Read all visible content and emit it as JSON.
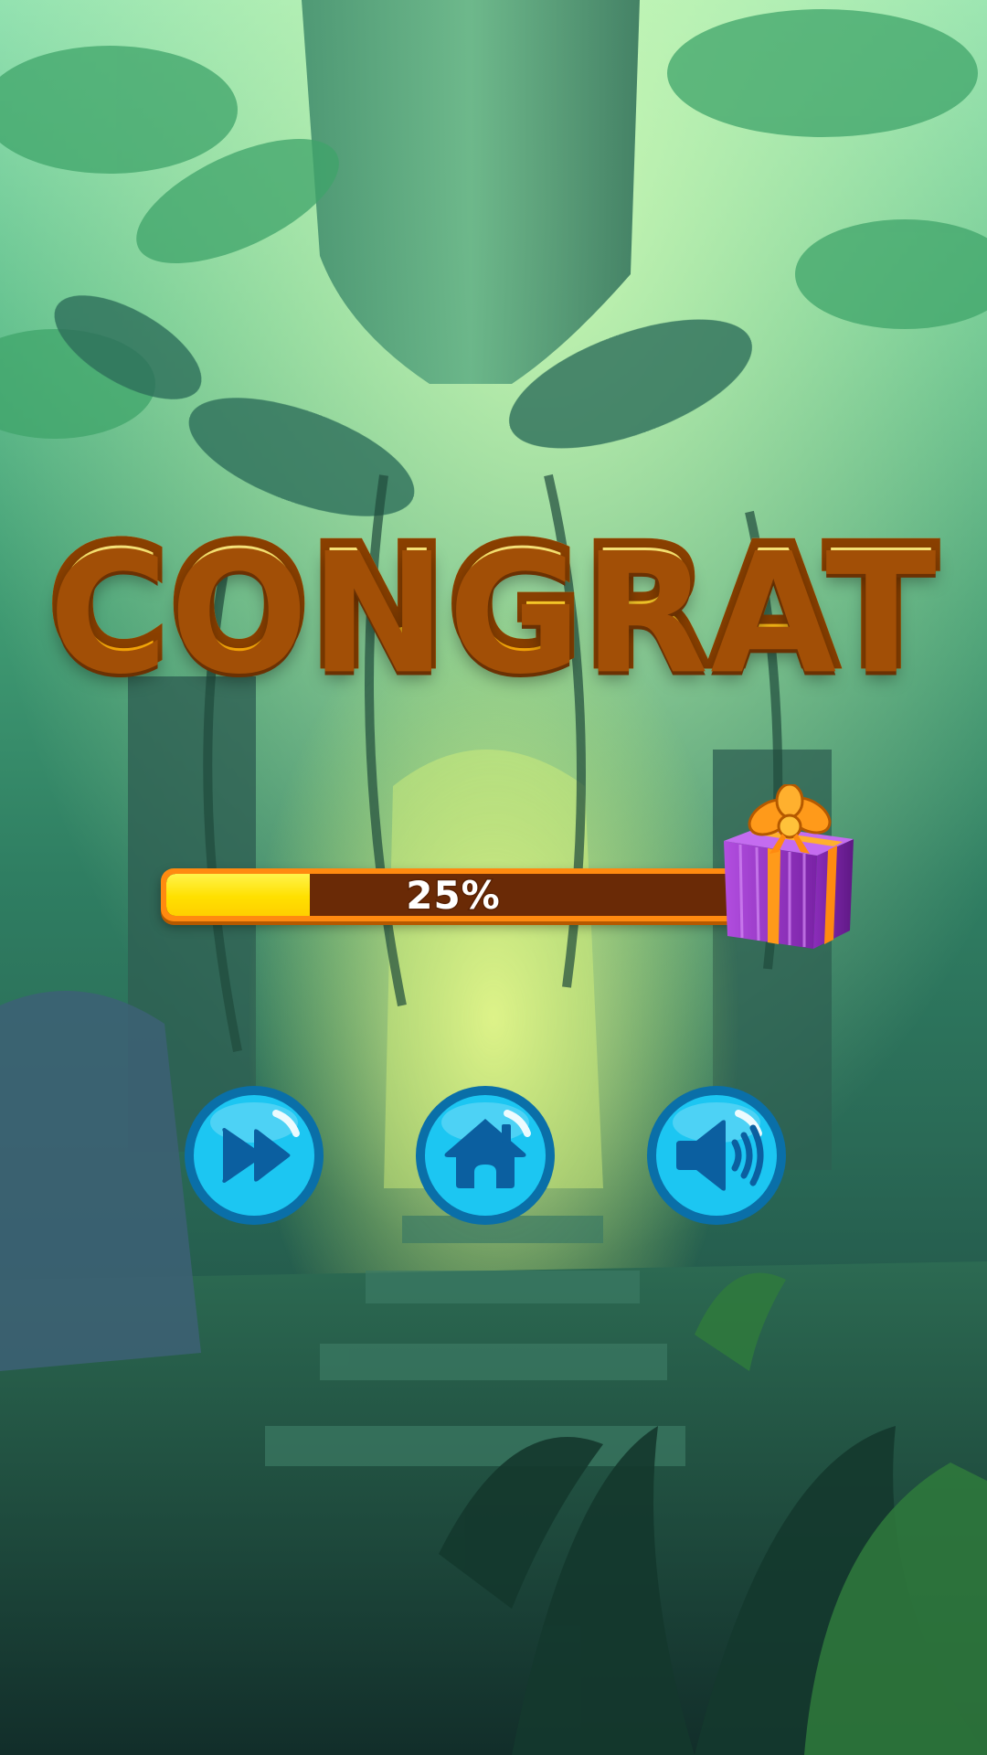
{
  "screen": {
    "title": "CONGRAT"
  },
  "progress": {
    "value": 0.25,
    "label": "25%"
  },
  "reward": {
    "icon": "gift-box-icon"
  },
  "buttons": [
    {
      "id": "next",
      "icon": "fast-forward-icon"
    },
    {
      "id": "home",
      "icon": "home-icon"
    },
    {
      "id": "sound",
      "icon": "speaker-icon"
    }
  ],
  "colors": {
    "title_fill": "#ffc20f",
    "title_outline": "#8a4000",
    "bar_frame": "#ff8a10",
    "bar_track": "#6a2a06",
    "bar_fill": "#ffe000",
    "button_fill": "#1cc6f2",
    "button_ring": "#0a6fa8",
    "icon_color": "#0b5fa0",
    "gift_box": "#9b38c8",
    "gift_ribbon": "#ff8a10"
  }
}
